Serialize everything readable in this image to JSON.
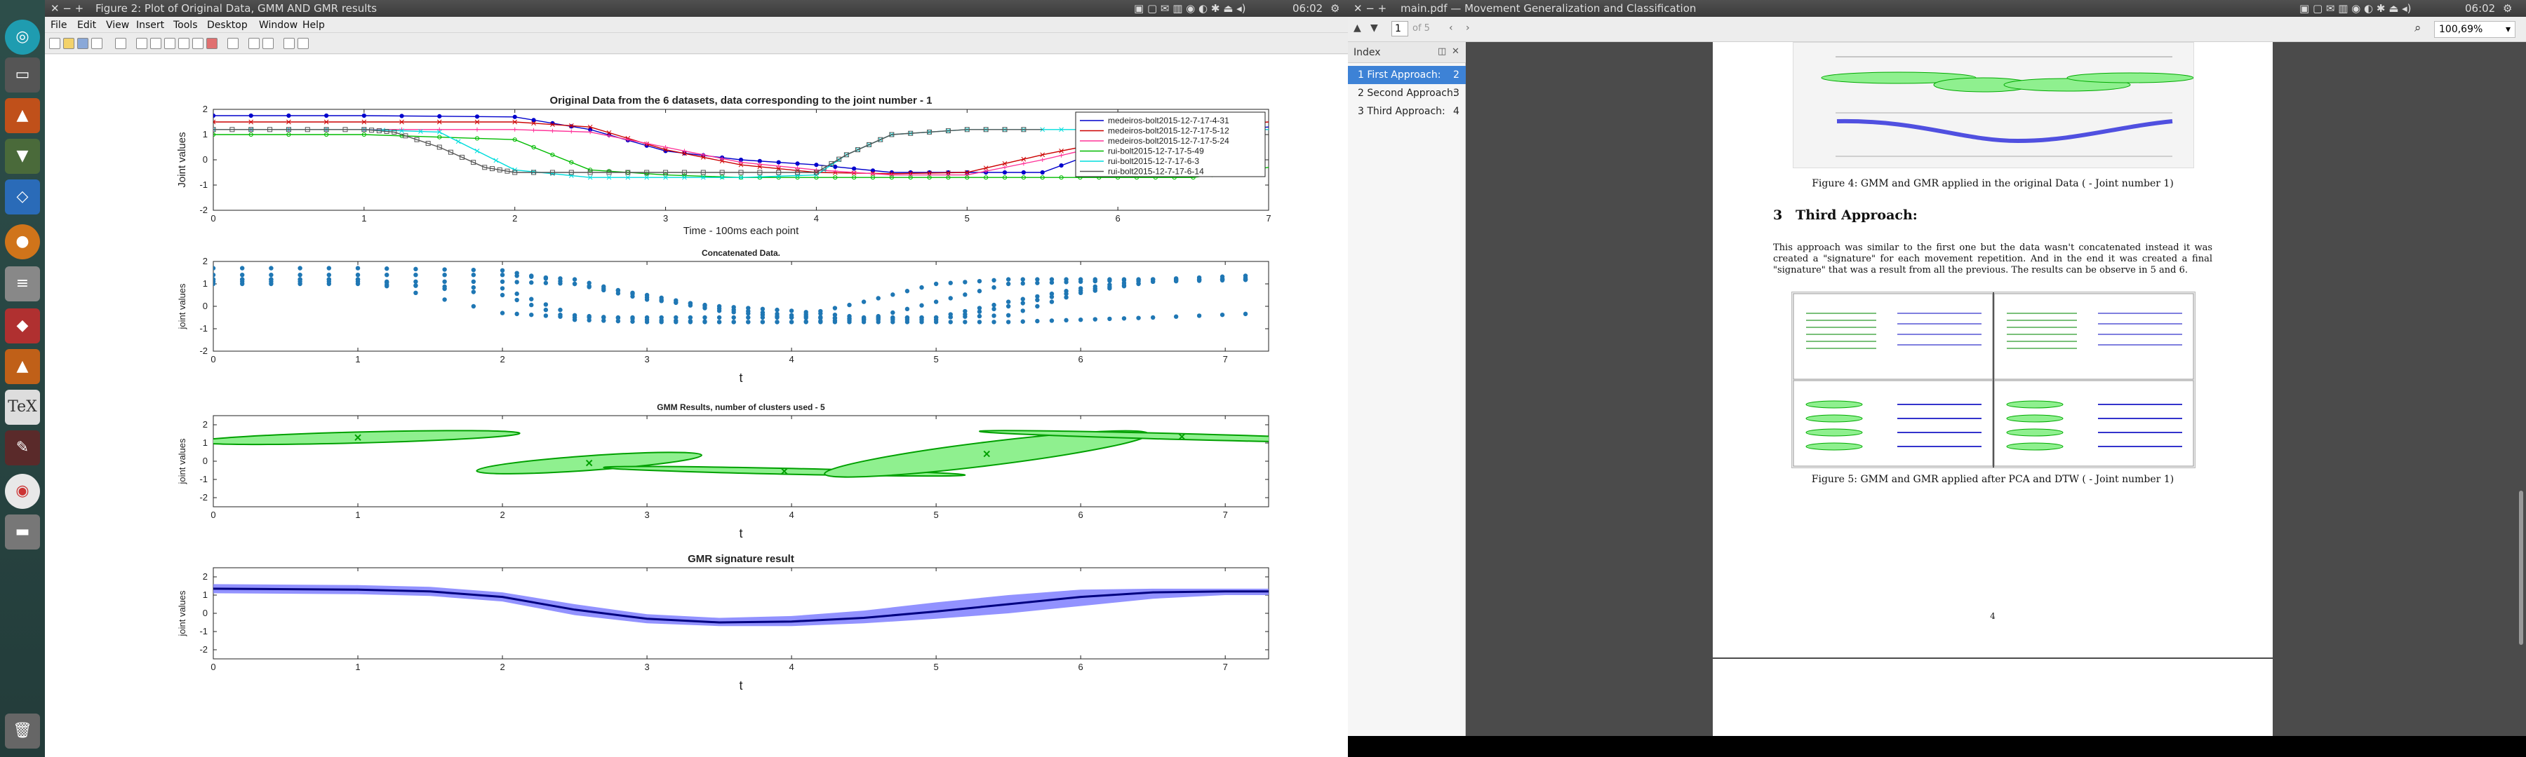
{
  "figure_window": {
    "title": "Figure 2: Plot of Original Data, GMM AND GMR results",
    "menu": [
      "File",
      "Edit",
      "View",
      "Insert",
      "Tools",
      "Desktop",
      "Window",
      "Help"
    ]
  },
  "system": {
    "time": "06:02"
  },
  "pdf_window": {
    "title": "main.pdf — Movement Generalization and Classification",
    "page_input": "1",
    "page_total": "of 5",
    "zoom": "100,69%",
    "time": "06:02",
    "sidebar": {
      "header": "Index",
      "items": [
        {
          "label": "1 First Approach:",
          "page": "2"
        },
        {
          "label": "2 Second Approach:",
          "page": "3"
        },
        {
          "label": "3 Third Approach:",
          "page": "4"
        }
      ]
    },
    "page": {
      "fig4_caption": "Figure 4: GMM and GMR applied in the original Data ( - Joint number 1)",
      "section_num": "3",
      "section_title": "Third Approach:",
      "paragraph": "This approach was similar to the first one but the data wasn't concatenated instead it was created a \"signature\" for each movement repetition. And in the end it was created a final \"signature\" that was a result from all the previous. The results can be observe in 5 and 6.",
      "fig5_caption": "Figure 5: GMM and GMR applied after PCA and DTW ( - Joint number 1)",
      "page_number": "4"
    }
  },
  "colors": {
    "series": [
      "#0000cc",
      "#cc0000",
      "#ff3399",
      "#00bb00",
      "#00dddd",
      "#555555"
    ],
    "gmm_fill": "#8ff08f",
    "gmm_edge": "#00a000",
    "gmr_band": "#7f7fff",
    "gmr_line": "#000080",
    "scatter": "#1f77b4"
  },
  "chart_data": [
    {
      "type": "line",
      "title": "Original Data from the 6 datasets, data corresponding to the joint number -  1",
      "xlabel": "Time - 100ms each point",
      "ylabel": "Joint values",
      "xlim": [
        0,
        7
      ],
      "ylim": [
        -2,
        2
      ],
      "xticks": [
        0,
        1,
        2,
        3,
        4,
        5,
        6,
        7
      ],
      "yticks": [
        -2,
        -1,
        0,
        1,
        2
      ],
      "legend": "top-right",
      "series": [
        {
          "name": "medeiros-bolt2015-12-7-17-4-31",
          "x": [
            0,
            1,
            2,
            2.5,
            3,
            3.5,
            4,
            4.5,
            5,
            5.5,
            6,
            6.5,
            7
          ],
          "values": [
            1.75,
            1.75,
            1.7,
            1.2,
            0.35,
            0.0,
            -0.2,
            -0.5,
            -0.5,
            -0.5,
            0.6,
            1.1,
            1.3
          ]
        },
        {
          "name": "medeiros-bolt2015-12-7-17-5-12",
          "x": [
            0,
            1,
            2,
            2.5,
            3,
            3.5,
            4,
            4.5,
            5,
            5.5,
            6,
            6.5,
            7
          ],
          "values": [
            1.5,
            1.5,
            1.5,
            1.3,
            0.4,
            -0.2,
            -0.5,
            -0.55,
            -0.5,
            0.2,
            0.8,
            1.3,
            1.5
          ]
        },
        {
          "name": "medeiros-bolt2015-12-7-17-5-24",
          "x": [
            0,
            1,
            2,
            2.5,
            3,
            3.5,
            4,
            4.5,
            5,
            5.5,
            6,
            6.5,
            7
          ],
          "values": [
            1.2,
            1.2,
            1.2,
            1.1,
            0.5,
            -0.1,
            -0.4,
            -0.6,
            -0.6,
            0.0,
            0.7,
            1.1,
            1.2
          ]
        },
        {
          "name": "rui-bolt2015-12-7-17-5-49",
          "x": [
            0,
            1,
            2,
            2.5,
            3,
            3.5,
            4,
            4.5,
            5,
            5.5,
            6,
            6.5,
            7
          ],
          "values": [
            1.0,
            1.0,
            0.8,
            -0.4,
            -0.6,
            -0.7,
            -0.7,
            -0.7,
            -0.7,
            -0.7,
            -0.7,
            -0.7,
            -0.3
          ]
        },
        {
          "name": "rui-bolt2015-12-7-17-6-3",
          "x": [
            0,
            1,
            1.5,
            2,
            2.5,
            3,
            3.5,
            4,
            4.2,
            4.5,
            5,
            5.5,
            6,
            6.5,
            7
          ],
          "values": [
            1.2,
            1.2,
            1.1,
            -0.4,
            -0.7,
            -0.7,
            -0.7,
            -0.6,
            0.2,
            1.0,
            1.2,
            1.2,
            1.2,
            1.2,
            1.2
          ]
        },
        {
          "name": "rui-bolt2015-12-7-17-6-14",
          "x": [
            0,
            0.5,
            1,
            1.2,
            1.5,
            1.8,
            2,
            2.5,
            3,
            3.5,
            4,
            4.2,
            4.5,
            5,
            5.5
          ],
          "values": [
            1.2,
            1.2,
            1.2,
            1.1,
            0.5,
            -0.3,
            -0.5,
            -0.5,
            -0.5,
            -0.5,
            -0.5,
            0.2,
            1.0,
            1.2,
            1.2
          ]
        }
      ]
    },
    {
      "type": "scatter",
      "title": "Concatenated Data.",
      "xlabel": "t",
      "ylabel": "joint values",
      "xlim": [
        0,
        7.3
      ],
      "ylim": [
        -2,
        2
      ],
      "xticks": [
        0,
        1,
        2,
        3,
        4,
        5,
        6,
        7
      ],
      "yticks": [
        -2,
        -1,
        0,
        1,
        2
      ],
      "x": [
        0,
        1,
        2,
        2.5,
        3,
        3.5,
        4,
        4.5,
        5,
        5.5,
        6,
        6.5,
        7.3
      ],
      "series_values": [
        [
          1.7,
          1.7,
          1.6,
          1.0,
          0.3,
          0.0,
          -0.2,
          -0.5,
          -0.5,
          -0.4,
          0.6,
          1.1,
          1.3
        ],
        [
          1.4,
          1.4,
          1.4,
          1.2,
          0.4,
          -0.2,
          -0.5,
          -0.55,
          -0.5,
          0.2,
          0.8,
          1.2,
          1.4
        ],
        [
          1.1,
          1.1,
          1.1,
          1.0,
          0.5,
          -0.1,
          -0.4,
          -0.6,
          -0.6,
          0.0,
          0.7,
          1.1,
          1.2
        ],
        [
          1.0,
          1.0,
          0.8,
          -0.4,
          -0.6,
          -0.7,
          -0.7,
          -0.7,
          -0.7,
          -0.7,
          -0.6,
          -0.5,
          -0.3
        ],
        [
          1.2,
          1.2,
          0.5,
          -0.6,
          -0.7,
          -0.7,
          -0.7,
          -0.6,
          0.2,
          1.0,
          1.1,
          1.2,
          1.2
        ],
        [
          1.2,
          1.2,
          -0.3,
          -0.5,
          -0.5,
          -0.5,
          -0.5,
          0.2,
          1.0,
          1.2,
          1.2,
          1.2,
          1.2
        ]
      ]
    },
    {
      "type": "ellipse",
      "title": "GMM Results, number of clusters used -  5",
      "xlabel": "t",
      "ylabel": "joint values",
      "xlim": [
        0,
        7.3
      ],
      "ylim": [
        -2.5,
        2.5
      ],
      "xticks": [
        0,
        1,
        2,
        3,
        4,
        5,
        6,
        7
      ],
      "yticks": [
        -2,
        -1,
        0,
        1,
        2
      ],
      "clusters": [
        {
          "cx": 1.0,
          "cy": 1.3,
          "rx": 1.12,
          "ry": 0.3,
          "angle": -1.5
        },
        {
          "cx": 2.6,
          "cy": -0.1,
          "rx": 0.78,
          "ry": 0.4,
          "angle": -4.0
        },
        {
          "cx": 3.95,
          "cy": -0.55,
          "rx": 1.25,
          "ry": 0.16,
          "angle": 1.2
        },
        {
          "cx": 5.35,
          "cy": 0.4,
          "rx": 1.13,
          "ry": 0.65,
          "angle": -7.0
        },
        {
          "cx": 6.7,
          "cy": 1.35,
          "rx": 1.4,
          "ry": 0.16,
          "angle": 1.5
        }
      ]
    },
    {
      "type": "area",
      "title": "GMR signature result",
      "xlabel": "t",
      "ylabel": "joint values",
      "xlim": [
        0,
        7.3
      ],
      "ylim": [
        -2.5,
        2.5
      ],
      "xticks": [
        0,
        1,
        2,
        3,
        4,
        5,
        6,
        7
      ],
      "yticks": [
        -2,
        -1,
        0,
        1,
        2
      ],
      "x": [
        0,
        1,
        1.5,
        2,
        2.5,
        3,
        3.5,
        4,
        4.5,
        5,
        5.5,
        6,
        6.5,
        7,
        7.3
      ],
      "mean": [
        1.35,
        1.3,
        1.2,
        0.9,
        0.2,
        -0.3,
        -0.5,
        -0.45,
        -0.25,
        0.1,
        0.5,
        0.9,
        1.15,
        1.2,
        1.2
      ],
      "upper": [
        1.6,
        1.55,
        1.45,
        1.15,
        0.5,
        -0.05,
        -0.25,
        -0.15,
        0.15,
        0.6,
        1.0,
        1.3,
        1.35,
        1.35,
        1.35
      ],
      "lower": [
        1.1,
        1.05,
        0.95,
        0.65,
        -0.1,
        -0.55,
        -0.7,
        -0.7,
        -0.55,
        -0.3,
        0.0,
        0.4,
        0.8,
        1.0,
        1.0
      ]
    }
  ]
}
